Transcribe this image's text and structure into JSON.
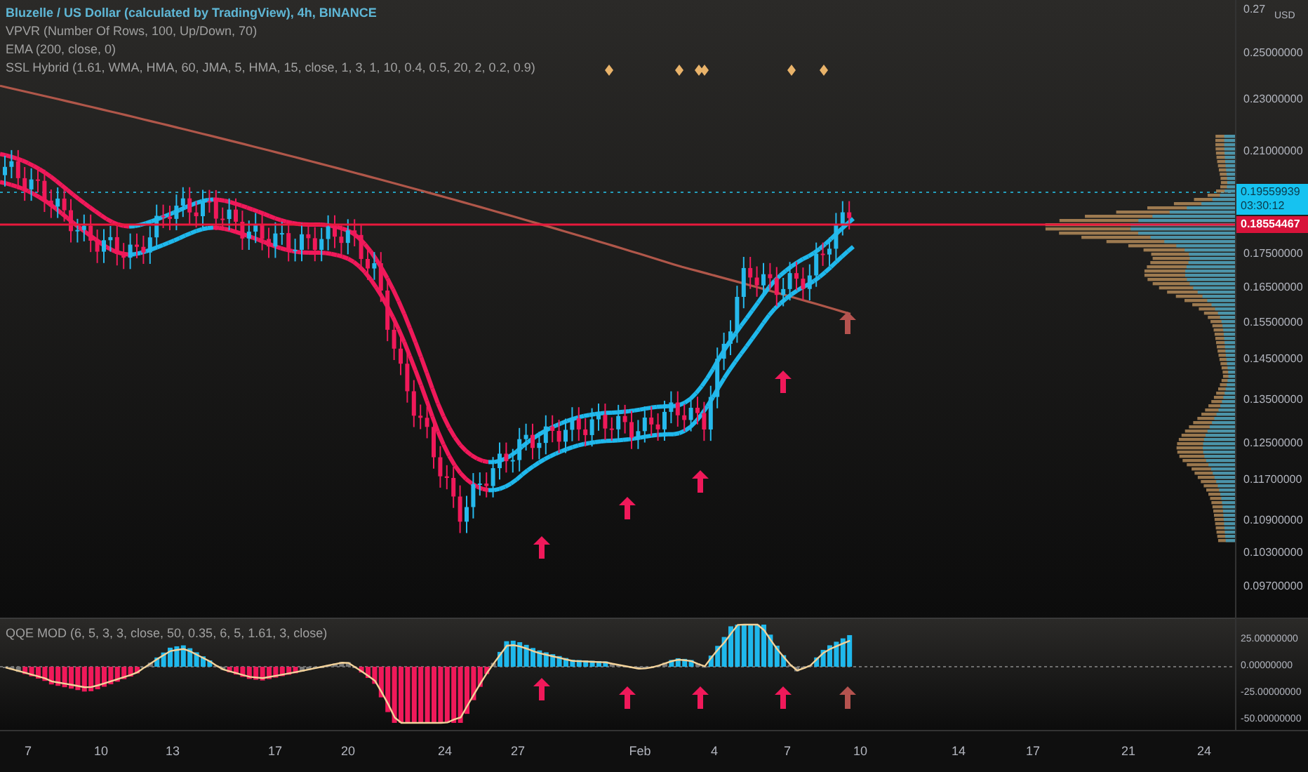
{
  "legend": {
    "symbol": "Bluzelle / US Dollar (calculated by TradingView), 4h, BINANCE",
    "indicators": [
      "VPVR (Number Of Rows, 100, Up/Down, 70)",
      "EMA (200, close, 0)",
      "SSL Hybrid (1.61, WMA, HMA, 60, JMA, 5, HMA, 15, close, 1, 3, 1, 10, 0.4, 0.5, 20, 2, 0.2, 0.9)"
    ]
  },
  "price_axis": {
    "unit": "USD",
    "labels": [
      "0.27",
      "0.25000000",
      "0.23000000",
      "0.21000000",
      "0.17500000",
      "0.16500000",
      "0.15500000",
      "0.14500000",
      "0.13500000",
      "0.12500000",
      "0.11700000",
      "0.10900000",
      "0.10300000",
      "0.09700000"
    ]
  },
  "price_tags": [
    {
      "kind": "last",
      "price": "0.19559939",
      "countdown": "03:30:12"
    },
    {
      "kind": "line",
      "price": "0.18554467"
    }
  ],
  "oscillator": {
    "title": "QQE MOD (6, 5, 3, 3, close, 50, 0.35, 6, 5, 1.61, 3, close)",
    "axis_labels": [
      "25.00000000",
      "0.00000000",
      "-25.00000000",
      "-50.00000000"
    ]
  },
  "time_axis": {
    "labels": [
      "7",
      "10",
      "13",
      "17",
      "20",
      "24",
      "27",
      "Feb",
      "4",
      "7",
      "10",
      "14",
      "17",
      "21",
      "24"
    ]
  }
}
